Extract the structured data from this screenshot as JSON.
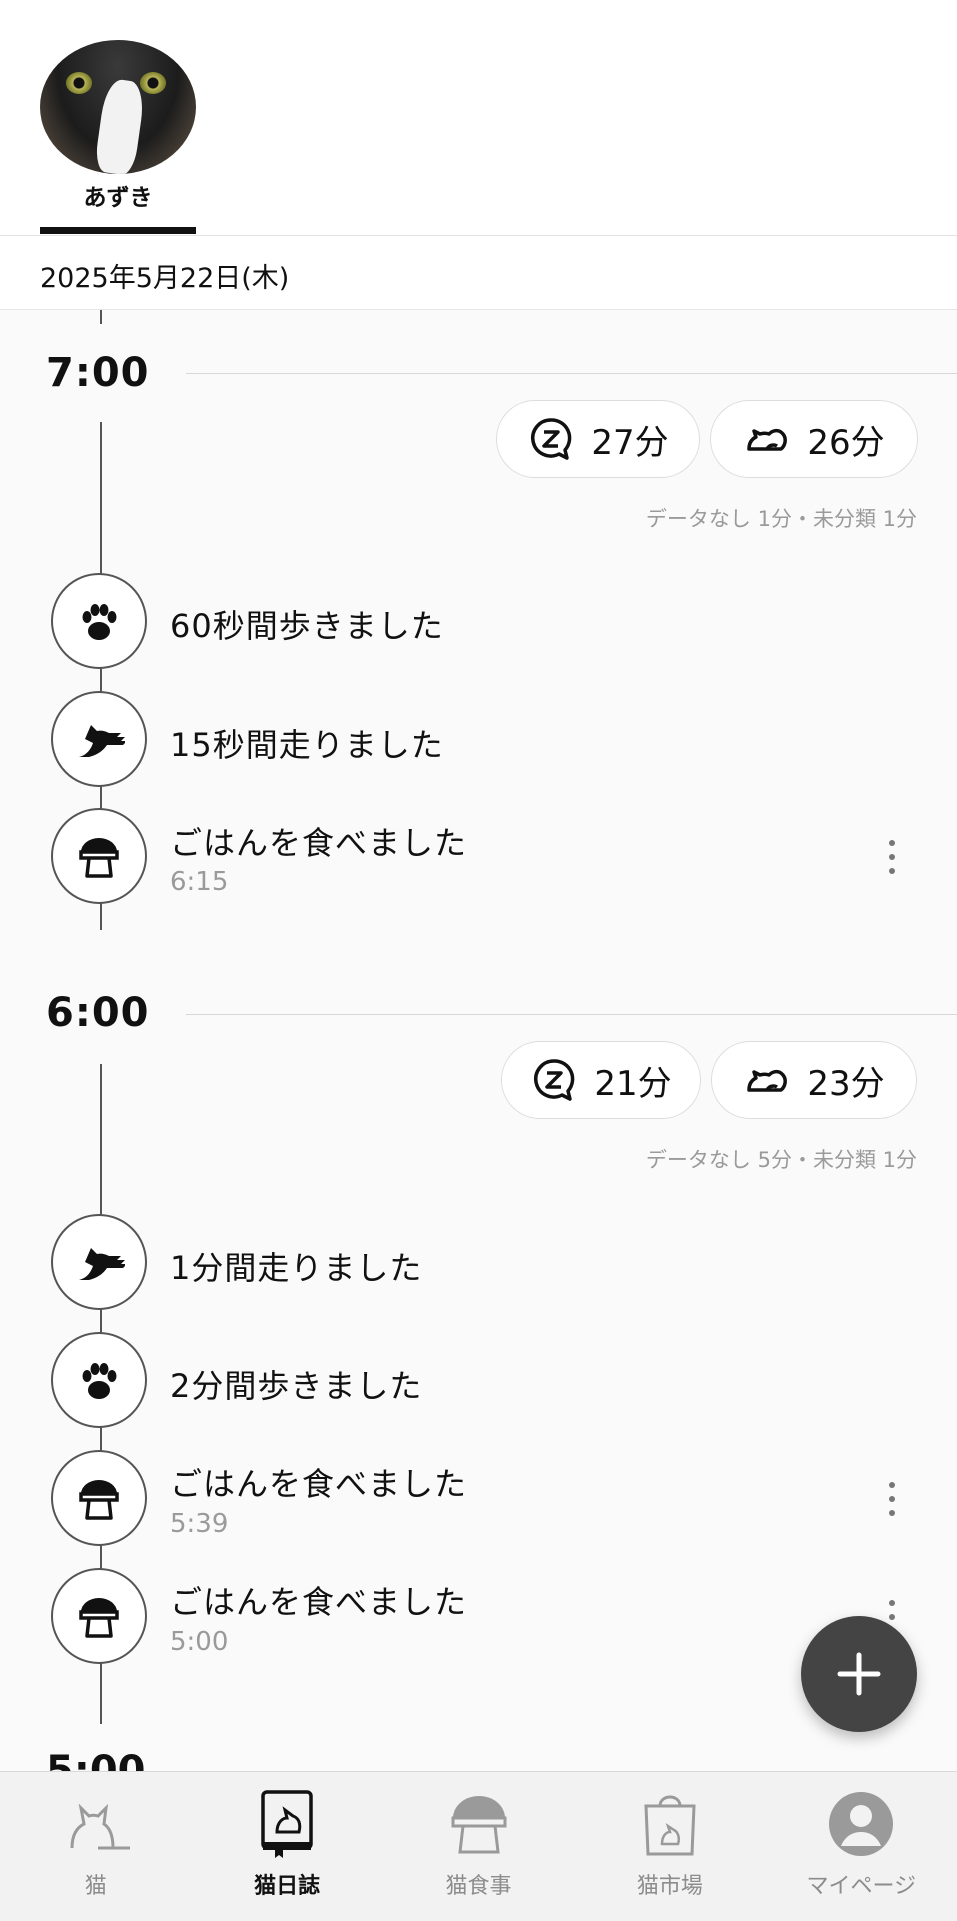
{
  "profile": {
    "cat_name": "あずき"
  },
  "date_label": "2025年5月22日(木)",
  "hours": [
    {
      "hour": "7:00",
      "sleep": "27分",
      "rest": "26分",
      "summary": "データなし 1分・未分類 1分",
      "events": [
        {
          "icon": "paw-icon",
          "text": "60秒間歩きました"
        },
        {
          "icon": "running-cat-icon",
          "text": "15秒間走りました"
        },
        {
          "icon": "food-bowl-icon",
          "text": "ごはんを食べました",
          "time": "6:15"
        }
      ]
    },
    {
      "hour": "6:00",
      "sleep": "21分",
      "rest": "23分",
      "summary": "データなし 5分・未分類 1分",
      "events": [
        {
          "icon": "running-cat-icon",
          "text": "1分間走りました"
        },
        {
          "icon": "paw-icon",
          "text": "2分間歩きました"
        },
        {
          "icon": "food-bowl-icon",
          "text": "ごはんを食べました",
          "time": "5:39"
        },
        {
          "icon": "food-bowl-icon",
          "text": "ごはんを食べました",
          "time": "5:00"
        }
      ]
    }
  ],
  "next_hour_partial": "5:00",
  "tabs": [
    {
      "label": "猫",
      "icon": "cat-icon",
      "active": false
    },
    {
      "label": "猫日誌",
      "icon": "diary-icon",
      "active": true
    },
    {
      "label": "猫食事",
      "icon": "food-bowl-icon",
      "active": false
    },
    {
      "label": "猫市場",
      "icon": "shopping-bag-icon",
      "active": false
    },
    {
      "label": "マイページ",
      "icon": "user-icon",
      "active": false
    }
  ],
  "colors": {
    "fab": "#444444",
    "active_tab": "#111111",
    "inactive_tab": "#8c8c8c"
  }
}
